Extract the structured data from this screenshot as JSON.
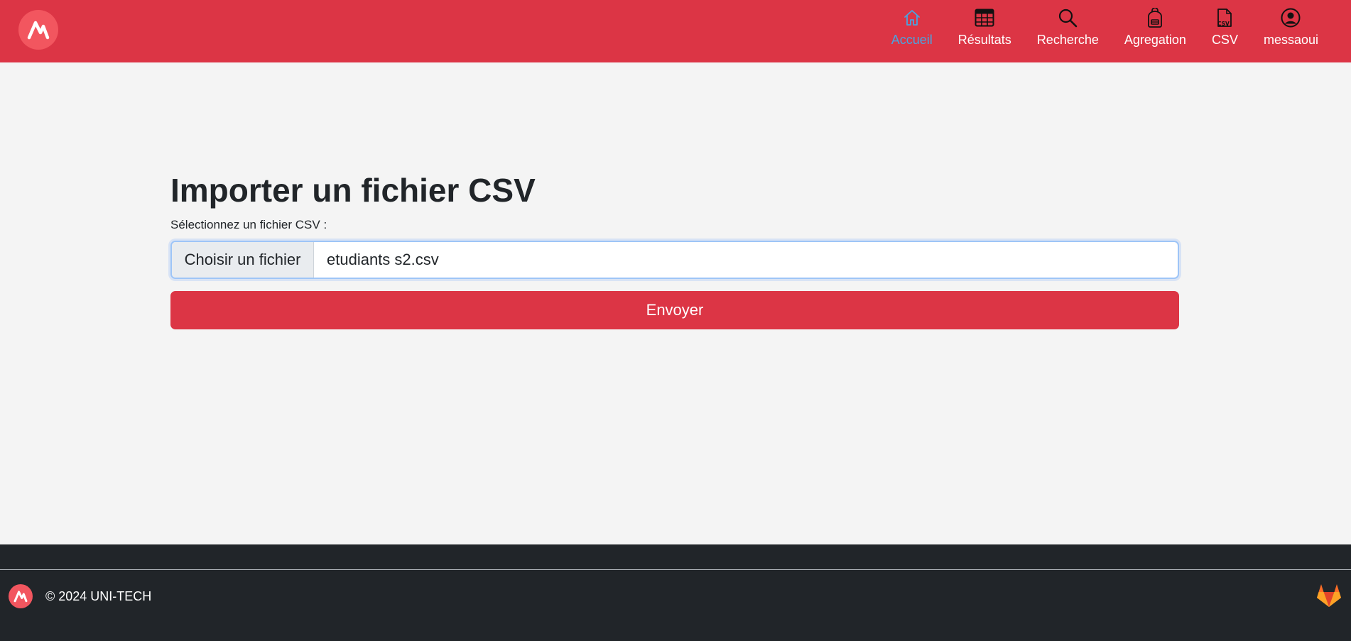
{
  "header": {
    "logo_icon": "unitech-logo-icon",
    "nav": [
      {
        "label": "Accueil",
        "icon": "home-icon",
        "active": true
      },
      {
        "label": "Résultats",
        "icon": "table-icon",
        "active": false
      },
      {
        "label": "Recherche",
        "icon": "search-icon",
        "active": false
      },
      {
        "label": "Agregation",
        "icon": "backpack-icon",
        "active": false
      },
      {
        "label": "CSV",
        "icon": "csv-file-icon",
        "active": false
      },
      {
        "label": "messaoui",
        "icon": "user-circle-icon",
        "active": false
      }
    ]
  },
  "main": {
    "title": "Importer un fichier CSV",
    "file_label": "Sélectionnez un fichier CSV :",
    "file_button": "Choisir un fichier",
    "file_value": "etudiants s2.csv",
    "submit_label": "Envoyer"
  },
  "footer": {
    "copyright": "© 2024 UNI-TECH",
    "logo_icon": "unitech-logo-icon",
    "link_icon": "gitlab-icon"
  },
  "colors": {
    "primary": "#dc3545",
    "active_nav": "#4aa3df",
    "background": "#f4f4f4",
    "footer": "#212529"
  }
}
